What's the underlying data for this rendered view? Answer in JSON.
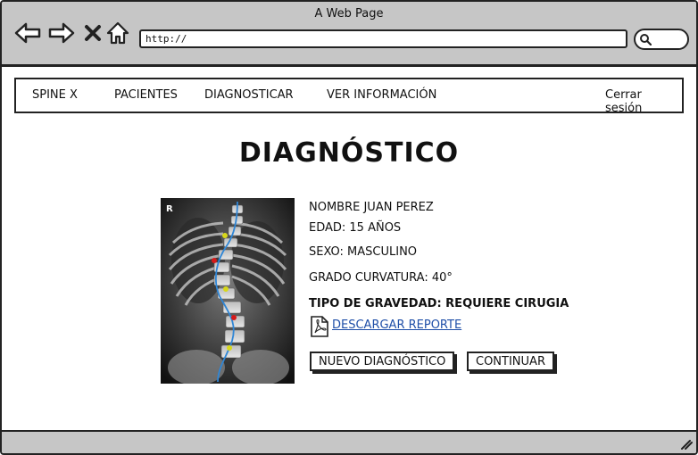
{
  "window": {
    "title": "A Web Page"
  },
  "browser": {
    "url": "http://"
  },
  "menu": {
    "brand": "SPINE X",
    "items": [
      "PACIENTES",
      "DIAGNOSTICAR",
      "VER INFORMACIÓN"
    ],
    "logout": "Cerrar sesión"
  },
  "page": {
    "title": "DIAGNÓSTICO"
  },
  "xray": {
    "marker": "R"
  },
  "patient": {
    "name": "NOMBRE JUAN PEREZ",
    "age": "EDAD: 15 AÑOS",
    "sex": "SEXO: MASCULINO",
    "curvature": "GRADO CURVATURA: 40°",
    "severity": "TIPO DE GRAVEDAD: REQUIERE CIRUGIA"
  },
  "report": {
    "download_label": "DESCARGAR REPORTE"
  },
  "actions": {
    "new_label": "NUEVO DIAGNÓSTICO",
    "continue_label": "CONTINUAR"
  }
}
